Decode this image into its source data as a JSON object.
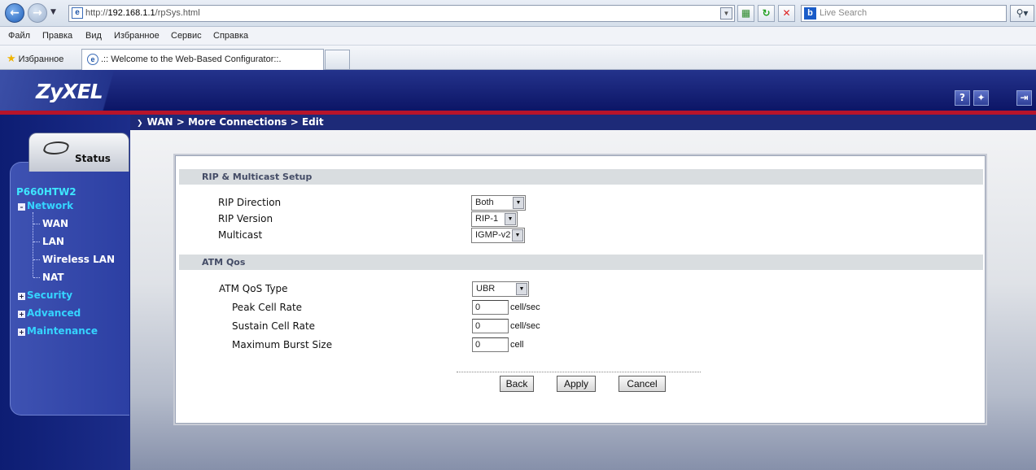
{
  "browser": {
    "url_prefix": "http://",
    "url_host": "192.168.1.1",
    "url_path": "/rpSys.html",
    "search_placeholder": "Live Search",
    "menu": [
      "Файл",
      "Правка",
      "Вид",
      "Избранное",
      "Сервис",
      "Справка"
    ],
    "favorites_label": "Избранное",
    "tab_title": ".:: Welcome to the Web-Based Configurator::."
  },
  "header": {
    "logo": "ZyXEL",
    "help_glyph": "?",
    "breadcrumb": "WAN > More Connections > Edit"
  },
  "sidebar": {
    "status_label": "Status",
    "model": "P660HTW2",
    "network": "Network",
    "network_items": [
      "WAN",
      "LAN",
      "Wireless LAN",
      "NAT"
    ],
    "security": "Security",
    "advanced": "Advanced",
    "maintenance": "Maintenance"
  },
  "rip": {
    "title": "RIP & Multicast Setup",
    "direction_label": "RIP Direction",
    "direction_value": "Both",
    "version_label": "RIP Version",
    "version_value": "RIP-1",
    "multicast_label": "Multicast",
    "multicast_value": "IGMP-v2"
  },
  "atm": {
    "title": "ATM Qos",
    "type_label": "ATM QoS Type",
    "type_value": "UBR",
    "pcr_label": "Peak Cell Rate",
    "pcr_value": "0",
    "pcr_unit": "cell/sec",
    "scr_label": "Sustain Cell Rate",
    "scr_value": "0",
    "scr_unit": "cell/sec",
    "mbs_label": "Maximum Burst Size",
    "mbs_value": "0",
    "mbs_unit": "cell"
  },
  "buttons": {
    "back": "Back",
    "apply": "Apply",
    "cancel": "Cancel"
  }
}
